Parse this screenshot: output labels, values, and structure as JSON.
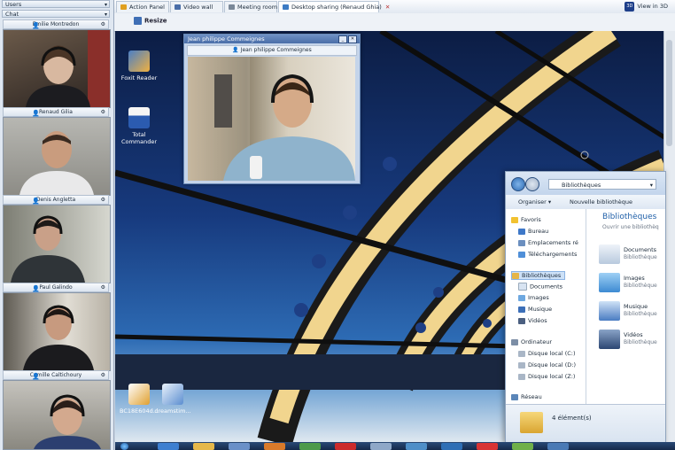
{
  "left_panel": {
    "users_label": "Users",
    "chat_label": "Chat",
    "participants": [
      {
        "name": "Emilie Montredon"
      },
      {
        "name": "Renaud Gilia"
      },
      {
        "name": "Denis Angletta"
      },
      {
        "name": "Paul Galindo"
      },
      {
        "name": "Camille Caltichoury"
      }
    ]
  },
  "tabs": [
    {
      "label": "Action Panel",
      "icon": "action-panel-icon",
      "active": false
    },
    {
      "label": "Video wall",
      "icon": "video-wall-icon",
      "active": false
    },
    {
      "label": "Meeting room",
      "icon": "meeting-room-icon",
      "active": false
    },
    {
      "label": "Desktop sharing (Renaud Ghia)",
      "icon": "desktop-sharing-icon",
      "active": true
    }
  ],
  "view3d_label": "View in 3D",
  "toolbar": {
    "resize_label": "Resize"
  },
  "desktop": {
    "icons": [
      {
        "label": "Foxit Reader"
      },
      {
        "label": "Total Commander"
      },
      {
        "label": "BC18E604d..."
      },
      {
        "label": "dreamstim..."
      }
    ]
  },
  "video_window": {
    "title": "Jean philippe Commeignes",
    "participant": "Jean philippe Commeignes"
  },
  "explorer": {
    "address": "Bibliothèques",
    "organize_label": "Organiser",
    "new_library_label": "Nouvelle bibliothèque",
    "nav": {
      "favorites": "Favoris",
      "favorite_items": [
        "Bureau",
        "Emplacements ré",
        "Téléchargements"
      ],
      "libraries": "Bibliothèques",
      "library_items": [
        "Documents",
        "Images",
        "Musique",
        "Vidéos"
      ],
      "computer": "Ordinateur",
      "disks": [
        "Disque local (C:)",
        "Disque local (D:)",
        "Disque local (Z:)"
      ],
      "network": "Réseau"
    },
    "main_title": "Bibliothèques",
    "main_subtitle": "Ouvrir une bibliothèq",
    "libraries": [
      {
        "name": "Documents",
        "type": "Bibliothèque"
      },
      {
        "name": "Images",
        "type": "Bibliothèque"
      },
      {
        "name": "Musique",
        "type": "Bibliothèque"
      },
      {
        "name": "Vidéos",
        "type": "Bibliothèque"
      }
    ],
    "status": "4 élément(s)"
  },
  "colors": {
    "accent": "#4a6ea8",
    "title_blue": "#1f5fa8",
    "tab_close": "#bb3333"
  }
}
